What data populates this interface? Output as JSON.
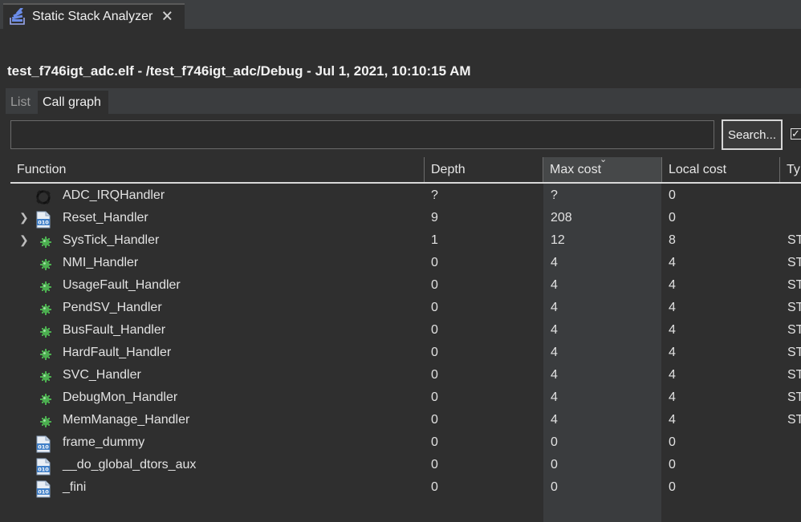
{
  "view_tab": {
    "title": "Static Stack Analyzer",
    "close_glyph": "🗙",
    "icon": "stack-analyzer-icon"
  },
  "header": {
    "text": "test_f746igt_adc.elf - /test_f746igt_adc/Debug - Jul 1, 2021, 10:10:15 AM"
  },
  "tabs": {
    "list_label": "List",
    "callgraph_label": "Call graph"
  },
  "search": {
    "value": "",
    "placeholder": "",
    "button_label": "Search...",
    "checkbox_checked": true
  },
  "table": {
    "columns": {
      "function": "Function",
      "depth": "Depth",
      "max_cost": "Max cost",
      "local_cost": "Local cost",
      "type": "Ty"
    },
    "sorted_column": "Max cost",
    "rows": [
      {
        "name": "ADC_IRQHandler",
        "depth": "?",
        "max": "?",
        "local": "0",
        "type": "",
        "icon": "recursion-icon",
        "expandable": false
      },
      {
        "name": "Reset_Handler",
        "depth": "9",
        "max": "208",
        "local": "0",
        "type": "",
        "icon": "object-file-icon",
        "expandable": true
      },
      {
        "name": "SysTick_Handler",
        "depth": "1",
        "max": "12",
        "local": "8",
        "type": "ST",
        "icon": "function-icon",
        "expandable": true
      },
      {
        "name": "NMI_Handler",
        "depth": "0",
        "max": "4",
        "local": "4",
        "type": "ST",
        "icon": "function-icon",
        "expandable": false
      },
      {
        "name": "UsageFault_Handler",
        "depth": "0",
        "max": "4",
        "local": "4",
        "type": "ST",
        "icon": "function-icon",
        "expandable": false
      },
      {
        "name": "PendSV_Handler",
        "depth": "0",
        "max": "4",
        "local": "4",
        "type": "ST",
        "icon": "function-icon",
        "expandable": false
      },
      {
        "name": "BusFault_Handler",
        "depth": "0",
        "max": "4",
        "local": "4",
        "type": "ST",
        "icon": "function-icon",
        "expandable": false
      },
      {
        "name": "HardFault_Handler",
        "depth": "0",
        "max": "4",
        "local": "4",
        "type": "ST",
        "icon": "function-icon",
        "expandable": false
      },
      {
        "name": "SVC_Handler",
        "depth": "0",
        "max": "4",
        "local": "4",
        "type": "ST",
        "icon": "function-icon",
        "expandable": false
      },
      {
        "name": "DebugMon_Handler",
        "depth": "0",
        "max": "4",
        "local": "4",
        "type": "ST",
        "icon": "function-icon",
        "expandable": false
      },
      {
        "name": "MemManage_Handler",
        "depth": "0",
        "max": "4",
        "local": "4",
        "type": "ST",
        "icon": "function-icon",
        "expandable": false
      },
      {
        "name": "frame_dummy",
        "depth": "0",
        "max": "0",
        "local": "0",
        "type": "",
        "icon": "object-file-icon",
        "expandable": false
      },
      {
        "name": "__do_global_dtors_aux",
        "depth": "0",
        "max": "0",
        "local": "0",
        "type": "",
        "icon": "object-file-icon",
        "expandable": false
      },
      {
        "name": "_fini",
        "depth": "0",
        "max": "0",
        "local": "0",
        "type": "",
        "icon": "object-file-icon",
        "expandable": false
      }
    ]
  },
  "colors": {
    "background": "#2f2f2f",
    "function_icon": "#4caf50",
    "header_rule": "#d8d8d8"
  }
}
